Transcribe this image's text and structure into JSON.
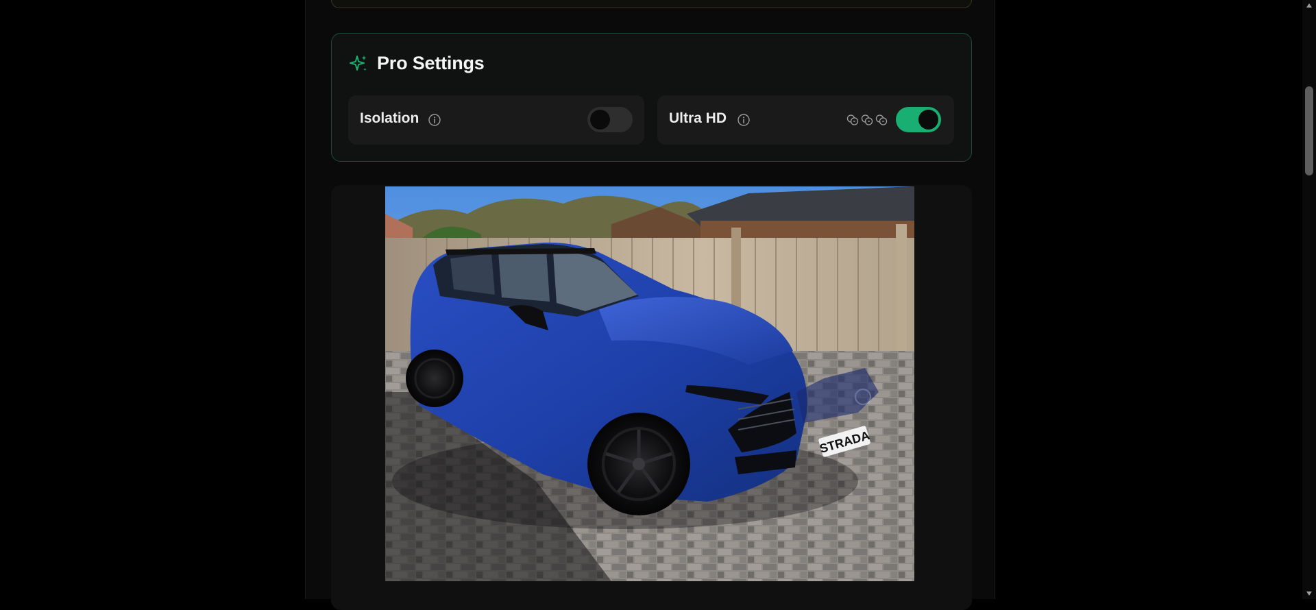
{
  "pro_settings": {
    "title": "Pro Settings",
    "icon": "sparkle-icon",
    "accent_color": "#1aaf72"
  },
  "isolation": {
    "label": "Isolation",
    "info_icon": "info-icon",
    "enabled": false
  },
  "ultra_hd": {
    "label": "Ultra HD",
    "info_icon": "info-icon",
    "credit_icons": [
      "coin-icon",
      "coin-icon",
      "coin-icon"
    ],
    "enabled": true
  },
  "preview": {
    "plate_text": "STRADA",
    "car_color": "#1d3fa8"
  }
}
